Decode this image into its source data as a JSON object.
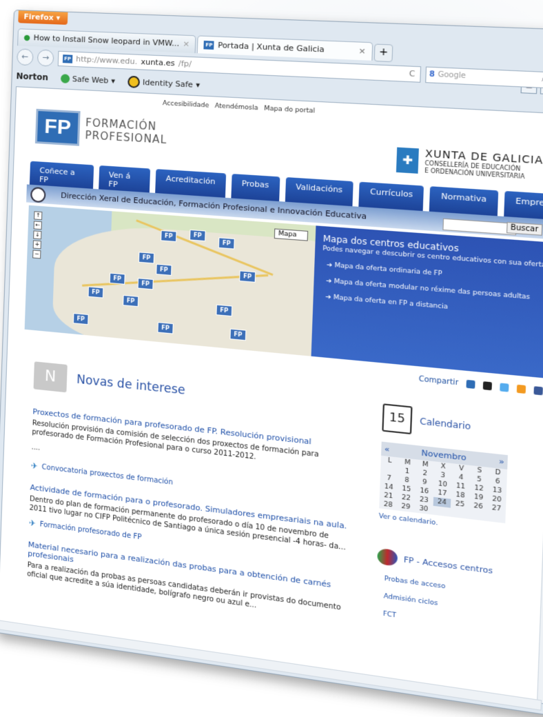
{
  "browser": {
    "menu_button": "Firefox",
    "tabs": [
      {
        "label": "How to Install Snow leopard in VMW..."
      },
      {
        "label": "Portada | Xunta de Galicia"
      }
    ],
    "new_tab": "+",
    "url_prefix": "http://www.edu.",
    "url_domain": "xunta.es",
    "url_path": "/fp/",
    "search_placeholder": "Google",
    "toolbar": {
      "norton": "Norton",
      "safe_web": "Safe Web",
      "identity_safe": "Identity Safe"
    }
  },
  "page": {
    "top_links": [
      "Accesibilidade",
      "Atendémosla",
      "Mapa do portal"
    ],
    "logo": {
      "mark": "FP",
      "line1": "FORMACIÓN",
      "line2": "PROFESIONAL"
    },
    "xunta": {
      "title": "XUNTA DE GALICIA",
      "line1": "CONSELLERÍA DE EDUCACIÓN",
      "line2": "E ORDENACIÓN UNIVERSITARIA"
    },
    "nav": [
      "Coñece a FP",
      "Ven á FP",
      "Acreditación",
      "Probas",
      "Validacións",
      "Currículos",
      "Normativa",
      "Empresa"
    ],
    "directorate": "Dirección Xeral de Educación, Formación Profesional e Innovación Educativa",
    "search_button": "Buscar",
    "map_select": "Mapa",
    "map_info": {
      "title": "Mapa dos centros educativos",
      "subtitle": "Podes navegar e descubrir os centro educativos con sua oferta.",
      "items": [
        "Mapa da oferta ordinaria de FP",
        "Mapa da oferta modular no réxime das persoas adultas",
        "Mapa da oferta en FP a distancia"
      ]
    },
    "share_label": "Compartir",
    "news": {
      "heading": "Novas de interese",
      "articles": [
        {
          "title": "Proxectos de formación para profesorado de FP. Resolución provisional",
          "body": "Resolución provisión da comisión de selección dos proxectos de formación para profesorado de Formación Profesional para o curso 2011-2012.",
          "more": "....",
          "link": "Convocatoria proxectos de formación"
        },
        {
          "title": "Actividade de formación para o profesorado. Simuladores empresariais na aula.",
          "body": "Dentro do plan de formación permanente do profesorado o día 10 de novembro de 2011 tivo lugar no CIFP Politécnico de Santiago a única sesión presencial -4 horas- da...",
          "link": "Formación profesorado de FP"
        },
        {
          "title": "Material necesario para a realización das probas para a obtención de carnés profesionais",
          "body": "Para a realización da probas as persoas candidatas deberán ir provistas do documento oficial que acredite a súa identidade, bolígrafo negro ou azul e..."
        }
      ]
    },
    "calendar": {
      "heading": "Calendario",
      "icon_day": "15",
      "month": "Novembro",
      "weekdays": [
        "L",
        "M",
        "M",
        "X",
        "V",
        "S",
        "D"
      ],
      "weeks": [
        [
          "",
          "1",
          "2",
          "3",
          "4",
          "5",
          "6"
        ],
        [
          "7",
          "8",
          "9",
          "10",
          "11",
          "12",
          "13"
        ],
        [
          "14",
          "15",
          "16",
          "17",
          "18",
          "19",
          "20"
        ],
        [
          "21",
          "22",
          "23",
          "24",
          "25",
          "26",
          "27"
        ],
        [
          "28",
          "29",
          "30",
          "",
          "",
          "",
          ""
        ]
      ],
      "today": "24",
      "view_link": "Ver o calendario."
    },
    "access": {
      "heading": "FP - Accesos centros",
      "links": [
        "Probas de acceso",
        "Admisión ciclos",
        "FCT"
      ]
    }
  }
}
